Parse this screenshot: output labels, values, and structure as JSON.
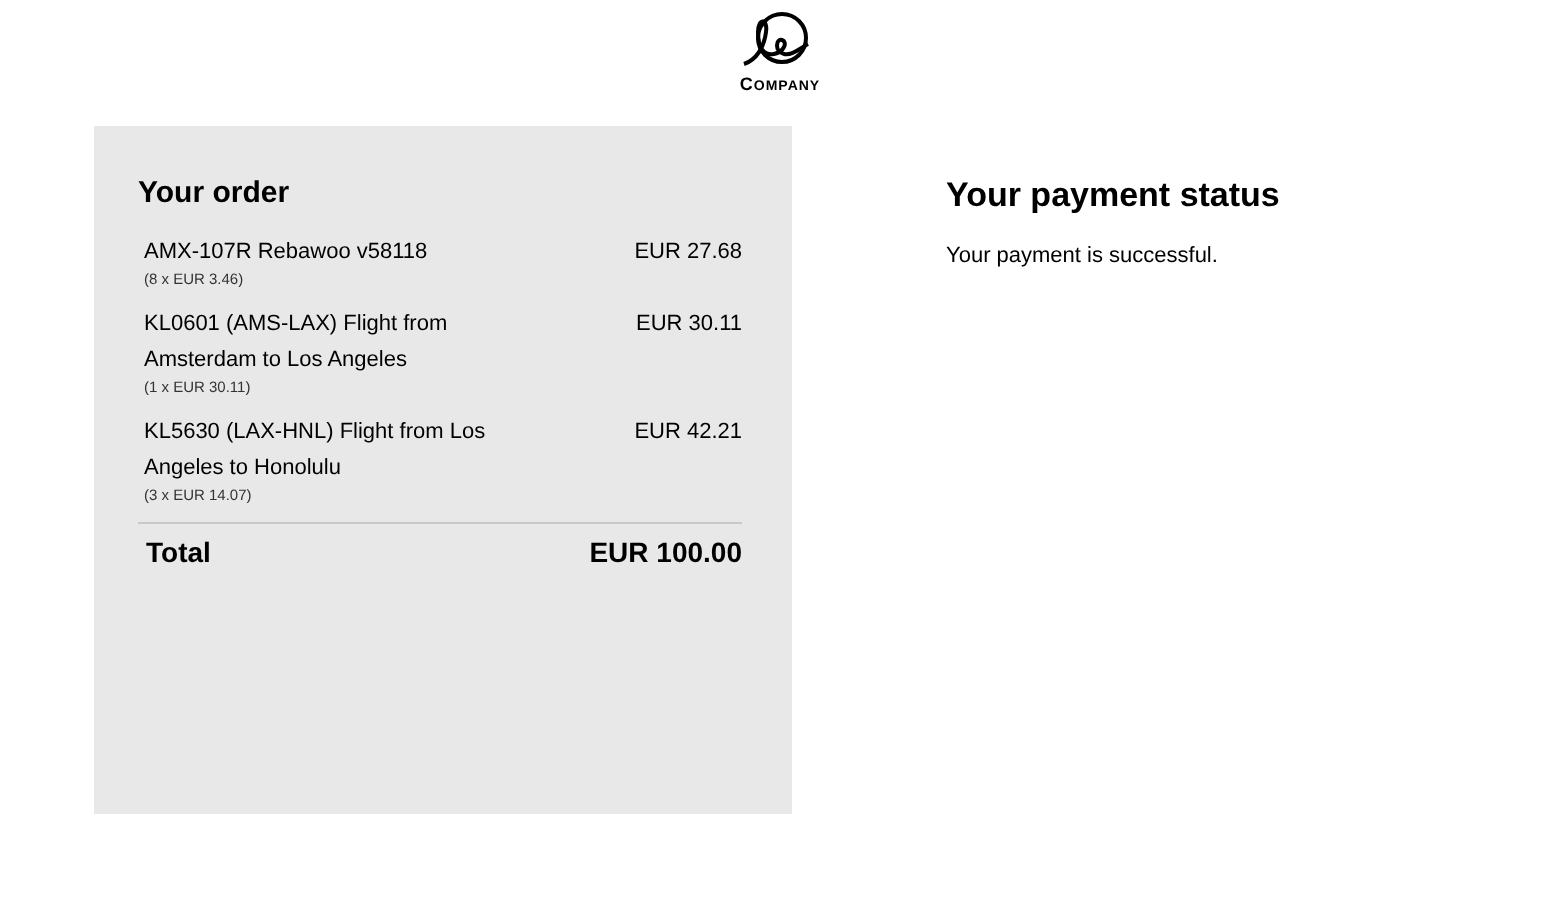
{
  "logo": {
    "wordmark": "COMPANY"
  },
  "order": {
    "title": "Your order",
    "items": [
      {
        "name": "AMX-107R Rebawoo v58118",
        "detail": "(8 x EUR 3.46)",
        "price": "EUR 27.68"
      },
      {
        "name": "KL0601 (AMS-LAX) Flight from Amsterdam to Los Angeles",
        "detail": "(1 x EUR 30.11)",
        "price": "EUR 30.11"
      },
      {
        "name": "KL5630 (LAX-HNL) Flight from Los Angeles to Honolulu",
        "detail": "(3 x EUR 14.07)",
        "price": "EUR 42.21"
      }
    ],
    "total_label": "Total",
    "total": "EUR 100.00"
  },
  "payment": {
    "title": "Your payment status",
    "message": "Your payment is successful."
  }
}
